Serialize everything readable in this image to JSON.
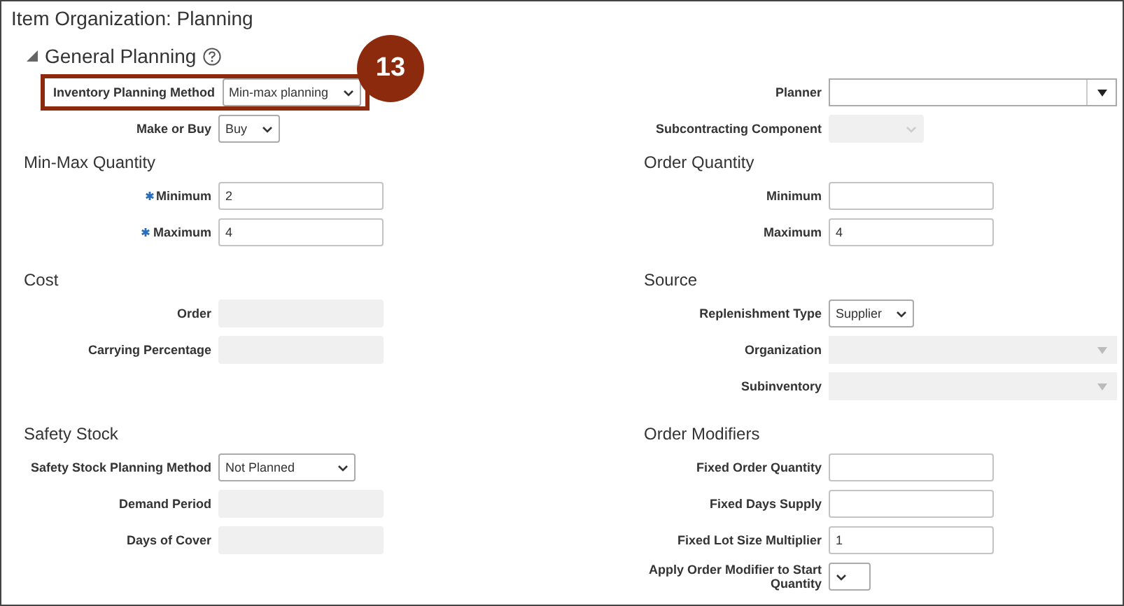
{
  "page_title": "Item Organization: Planning",
  "general_planning": {
    "title": "General Planning",
    "expanded": true,
    "callout_badge": "13",
    "left": [
      {
        "label": "Inventory Planning Method",
        "kind": "select",
        "value": "Min-max planning",
        "required": false,
        "disabled": false,
        "highlighted": true
      },
      {
        "label": "Make or Buy",
        "kind": "select",
        "value": "Buy",
        "required": false,
        "disabled": false,
        "highlighted": false
      }
    ],
    "right": [
      {
        "label": "Planner",
        "kind": "lov",
        "required": false,
        "disabled": false,
        "highlighted": false
      },
      {
        "label": "Subcontracting Component",
        "kind": "select",
        "required": false,
        "disabled": true,
        "highlighted": false
      }
    ]
  },
  "section_rows": [
    {
      "left": {
        "title": "Min-Max Quantity",
        "fields": [
          {
            "label": "Minimum",
            "kind": "text",
            "value": "2",
            "required": true,
            "disabled": false,
            "highlighted": false
          },
          {
            "label": "Maximum",
            "kind": "text",
            "value": "4",
            "required": true,
            "disabled": false,
            "highlighted": false
          }
        ]
      },
      "right": {
        "title": "Order Quantity",
        "fields": [
          {
            "label": "Minimum",
            "kind": "text",
            "required": false,
            "disabled": false,
            "highlighted": false
          },
          {
            "label": "Maximum",
            "kind": "text",
            "value": "4",
            "required": false,
            "disabled": false,
            "highlighted": false
          }
        ]
      }
    },
    {
      "left": {
        "title": "Cost",
        "fields": [
          {
            "label": "Order",
            "kind": "text",
            "required": false,
            "disabled": true,
            "highlighted": false
          },
          {
            "label": "Carrying Percentage",
            "kind": "text",
            "required": false,
            "disabled": true,
            "highlighted": false
          }
        ]
      },
      "right": {
        "title": "Source",
        "fields": [
          {
            "label": "Replenishment Type",
            "kind": "select",
            "value": "Supplier",
            "required": false,
            "disabled": false,
            "highlighted": false
          },
          {
            "label": "Organization",
            "kind": "lov",
            "required": false,
            "disabled": true,
            "highlighted": false
          },
          {
            "label": "Subinventory",
            "kind": "lov",
            "required": false,
            "disabled": true,
            "highlighted": false
          }
        ]
      }
    },
    {
      "left": {
        "title": "Safety Stock",
        "fields": [
          {
            "label": "Safety Stock Planning Method",
            "kind": "select",
            "value": "Not Planned",
            "required": false,
            "disabled": false,
            "highlighted": false
          },
          {
            "label": "Demand Period",
            "kind": "text",
            "required": false,
            "disabled": true,
            "highlighted": false
          },
          {
            "label": "Days of Cover",
            "kind": "text",
            "required": false,
            "disabled": true,
            "highlighted": false
          }
        ]
      },
      "right": {
        "title": "Order Modifiers",
        "fields": [
          {
            "label": "Fixed Order Quantity",
            "kind": "text",
            "required": false,
            "disabled": false,
            "highlighted": false
          },
          {
            "label": "Fixed Days Supply",
            "kind": "text",
            "required": false,
            "disabled": false,
            "highlighted": false
          },
          {
            "label": "Fixed Lot Size Multiplier",
            "kind": "text",
            "value": "1",
            "required": false,
            "disabled": false,
            "highlighted": false
          },
          {
            "label": "Apply Order Modifier to Start Quantity",
            "kind": "select",
            "required": false,
            "disabled": false,
            "highlighted": false
          }
        ]
      }
    }
  ]
}
